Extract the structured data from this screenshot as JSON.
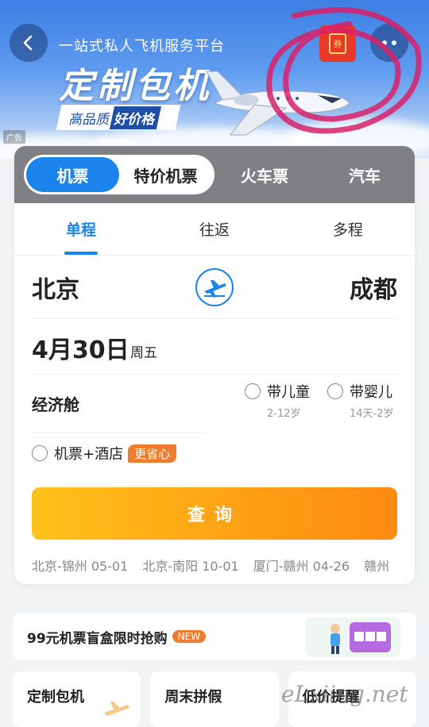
{
  "banner": {
    "subtitle": "一站式私人飞机服务平台",
    "title": "定制包机",
    "slogan_pre": "高品质",
    "slogan_hl": "好价格",
    "ad_tag": "广告",
    "coupon_label": "券",
    "back_icon": "chevron-left-icon",
    "more_icon": "more-dots-icon"
  },
  "mode_tabs": [
    "机票",
    "特价机票",
    "火车票",
    "汽车"
  ],
  "trip_tabs": [
    "单程",
    "往返",
    "多程"
  ],
  "route": {
    "from": "北京",
    "to": "成都"
  },
  "date": {
    "day": "4月30日",
    "weekday": "周五"
  },
  "cabin": {
    "class": "经济舱",
    "child_label": "带儿童",
    "child_age": "2-12岁",
    "infant_label": "带婴儿",
    "infant_age": "14天-2岁"
  },
  "hotel": {
    "label": "机票+酒店",
    "badge": "更省心"
  },
  "search_label": "查询",
  "history": [
    "北京-锦州 05-01",
    "北京-南阳 10-01",
    "厦门-赣州 04-26",
    "赣州"
  ],
  "promo": {
    "text": "99元机票盲盒限时抢购",
    "badge": "NEW"
  },
  "tiles": [
    "定制包机",
    "周末拼假",
    "低价提醒"
  ],
  "watermark": "eLxiing.net",
  "colors": {
    "accent": "#1a84ea",
    "orange": "#ff9f14",
    "badge": "#ef7d30"
  }
}
